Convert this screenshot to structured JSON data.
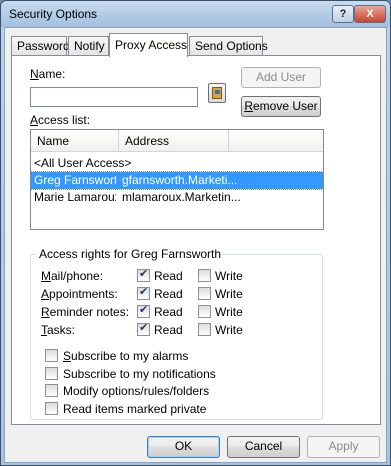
{
  "window": {
    "title": "Security Options",
    "help_glyph": "?",
    "close_glyph": "X"
  },
  "tabs": [
    {
      "label": "Password",
      "active": false
    },
    {
      "label": "Notify",
      "active": false
    },
    {
      "label": "Proxy Access",
      "active": true
    },
    {
      "label": "Send Options",
      "active": false
    }
  ],
  "name_field": {
    "label": "Name:",
    "value": ""
  },
  "buttons": {
    "add_user": "Add User",
    "remove_user": "Remove User",
    "address_book_icon": "address-book-icon"
  },
  "access_list": {
    "label": "Access list:",
    "columns": [
      "Name",
      "Address"
    ],
    "rows": [
      {
        "name": "<All User Access>",
        "address": "",
        "selected": false
      },
      {
        "name": "Greg Farnsworth",
        "address": "gfarnsworth.Marketi...",
        "selected": true
      },
      {
        "name": "Marie Lamaroux",
        "address": "mlamaroux.Marketin...",
        "selected": false
      }
    ]
  },
  "access_rights": {
    "title": "Access rights for Greg Farnsworth",
    "read_label": "Read",
    "write_label": "Write",
    "items": [
      {
        "label": "Mail/phone:",
        "read": true,
        "write": false
      },
      {
        "label": "Appointments:",
        "read": true,
        "write": false
      },
      {
        "label": "Reminder notes:",
        "read": true,
        "write": false
      },
      {
        "label": "Tasks:",
        "read": true,
        "write": false
      }
    ],
    "options": [
      {
        "label": "Subscribe to my alarms",
        "checked": false
      },
      {
        "label": "Subscribe to my notifications",
        "checked": false
      },
      {
        "label": "Modify options/rules/folders",
        "checked": false
      },
      {
        "label": "Read items marked private",
        "checked": false
      }
    ]
  },
  "footer": {
    "ok": "OK",
    "cancel": "Cancel",
    "apply": "Apply"
  },
  "colors": {
    "selection": "#3399ff",
    "title_bar": "#b1cbe6",
    "close_button": "#c9442f"
  }
}
